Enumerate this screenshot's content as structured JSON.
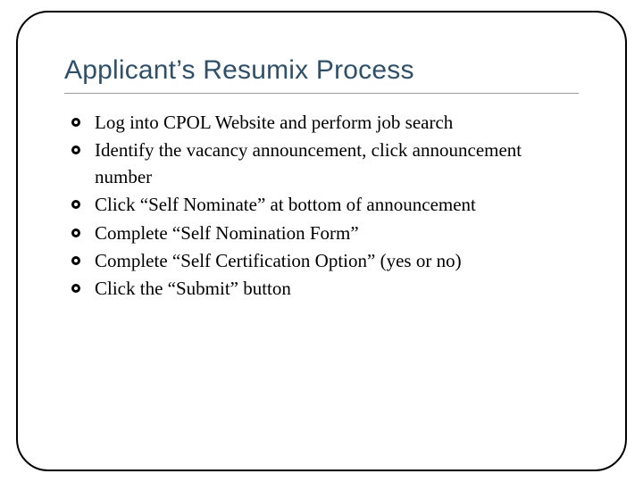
{
  "slide": {
    "title": "Applicant’s Resumix Process",
    "bullets": [
      "Log into CPOL Website and perform job search",
      "Identify the vacancy announcement, click announcement number",
      "Click “Self Nominate” at bottom of announcement",
      "Complete “Self Nomination Form”",
      "Complete “Self Certification Option” (yes or no)",
      "Click the “Submit” button"
    ]
  }
}
